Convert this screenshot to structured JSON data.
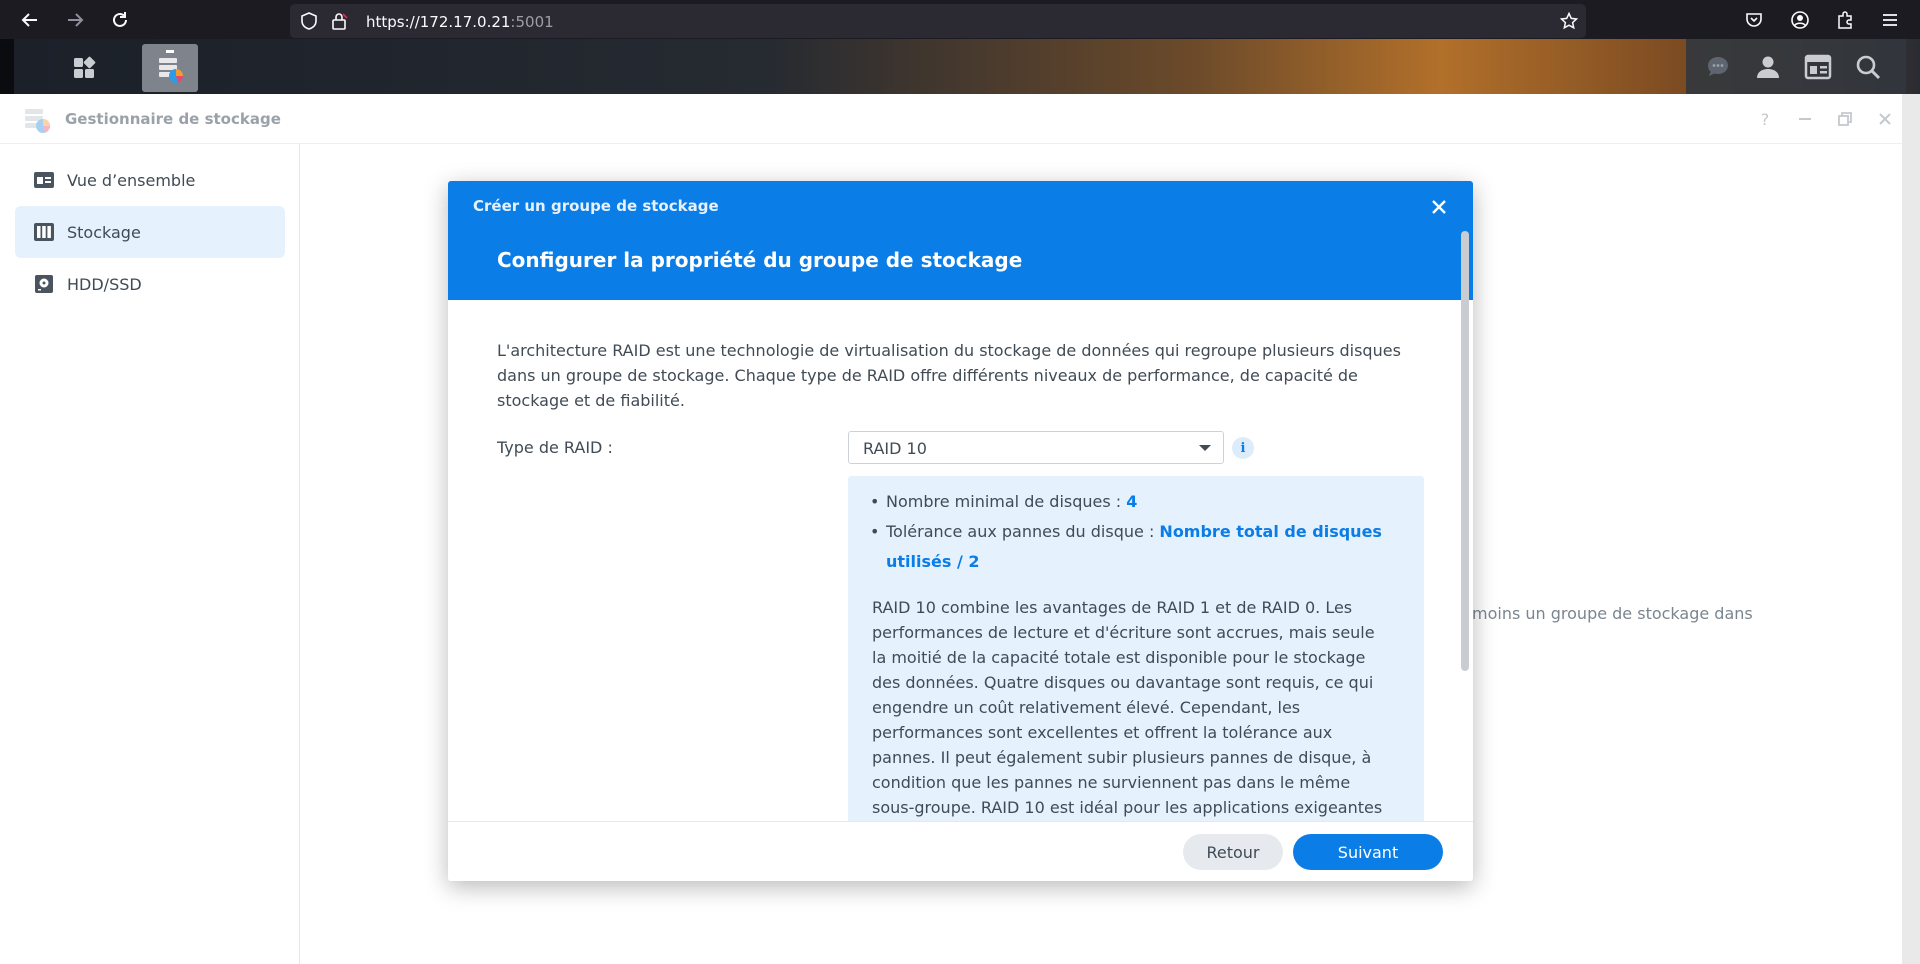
{
  "browser": {
    "url_main": "https://172.17.0.21",
    "url_port": ":5001",
    "icons": [
      "back-arrow-icon",
      "forward-arrow-icon",
      "reload-icon",
      "shield-icon",
      "lock-icon",
      "star-icon",
      "pocket-icon",
      "account-icon",
      "extensions-icon",
      "menu-icon"
    ]
  },
  "taskbar": {
    "icons": [
      "main-menu-icon",
      "storage-manager-app-icon",
      "chat-icon",
      "user-icon",
      "widgets-icon",
      "search-icon"
    ]
  },
  "app": {
    "title": "Gestionnaire de stockage",
    "window_controls": [
      "help-icon",
      "minimize-icon",
      "restore-icon",
      "close-icon"
    ],
    "sidebar": [
      {
        "label": "Vue d’ensemble",
        "icon": "overview-icon",
        "active": false
      },
      {
        "label": "Stockage",
        "icon": "storage-icon",
        "active": true
      },
      {
        "label": "HDD/SSD",
        "icon": "disk-icon",
        "active": false
      }
    ],
    "background_text": "moins un groupe de stockage dans"
  },
  "dialog": {
    "small_title": "Créer un groupe de stockage",
    "title": "Configurer la propriété du groupe de stockage",
    "intro_lines": [
      "L'architecture RAID est une technologie de virtualisation du stockage de données qui regroupe plusieurs disques",
      "dans un groupe de stockage. Chaque type de RAID offre différents niveaux de performance, de capacité de",
      "stockage et de fiabilité."
    ],
    "raid_label": "Type de RAID :",
    "raid_value": "RAID 10",
    "info_icon_text": "i",
    "min_disks_label": "Nombre minimal de disques :",
    "min_disks_value": "4",
    "tolerance_label": "Tolérance aux pannes du disque :",
    "tolerance_value_line1": "Nombre total de disques",
    "tolerance_value_line2": "utilisés / 2",
    "description_lines": [
      "RAID 10 combine les avantages de RAID 1 et de RAID 0. Les",
      "performances de lecture et d'écriture sont accrues, mais seule",
      "la moitié de la capacité totale est disponible pour le stockage",
      "des données. Quatre disques ou davantage sont requis, ce qui",
      "engendre un coût relativement élevé. Cependant, les",
      "performances sont excellentes et offrent la tolérance aux",
      "pannes. Il peut également subir plusieurs pannes de disque, à",
      "condition que les pannes ne surviennent pas dans le même",
      "sous-groupe. RAID 10 est idéal pour les applications exigeantes"
    ],
    "back_label": "Retour",
    "next_label": "Suivant"
  },
  "colors": {
    "accent": "#0a7de7",
    "info_bg": "#e5f1fd",
    "text": "#414b55"
  }
}
